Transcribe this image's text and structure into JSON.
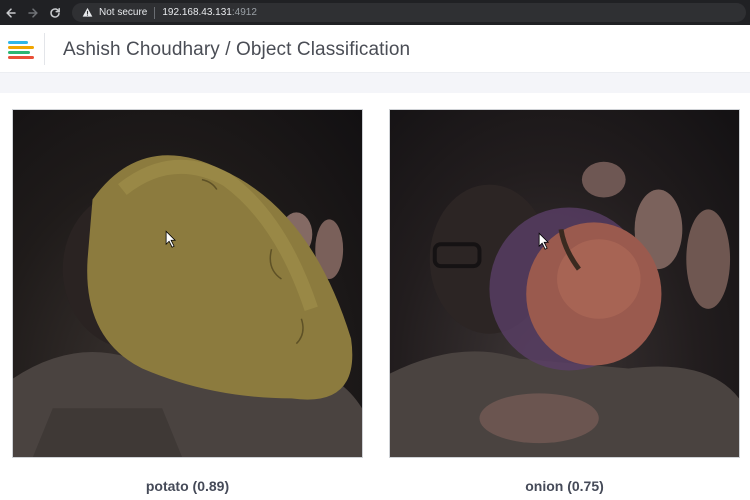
{
  "browser": {
    "back_icon": "arrow-left-icon",
    "forward_icon": "arrow-right-icon",
    "reload_icon": "reload-icon",
    "security_label": "Not secure",
    "url_host": "192.168.43.131",
    "url_port": ":4912"
  },
  "header": {
    "logo_icon": "edge-impulse-logo",
    "title": "Ashish Choudhary / Object Classification"
  },
  "results": [
    {
      "label": "potato (0.89)"
    },
    {
      "label": "onion (0.75)"
    }
  ],
  "colors": {
    "logo_bars": [
      "#2fb6e8",
      "#f0a500",
      "#2bb673",
      "#e94f37"
    ]
  }
}
